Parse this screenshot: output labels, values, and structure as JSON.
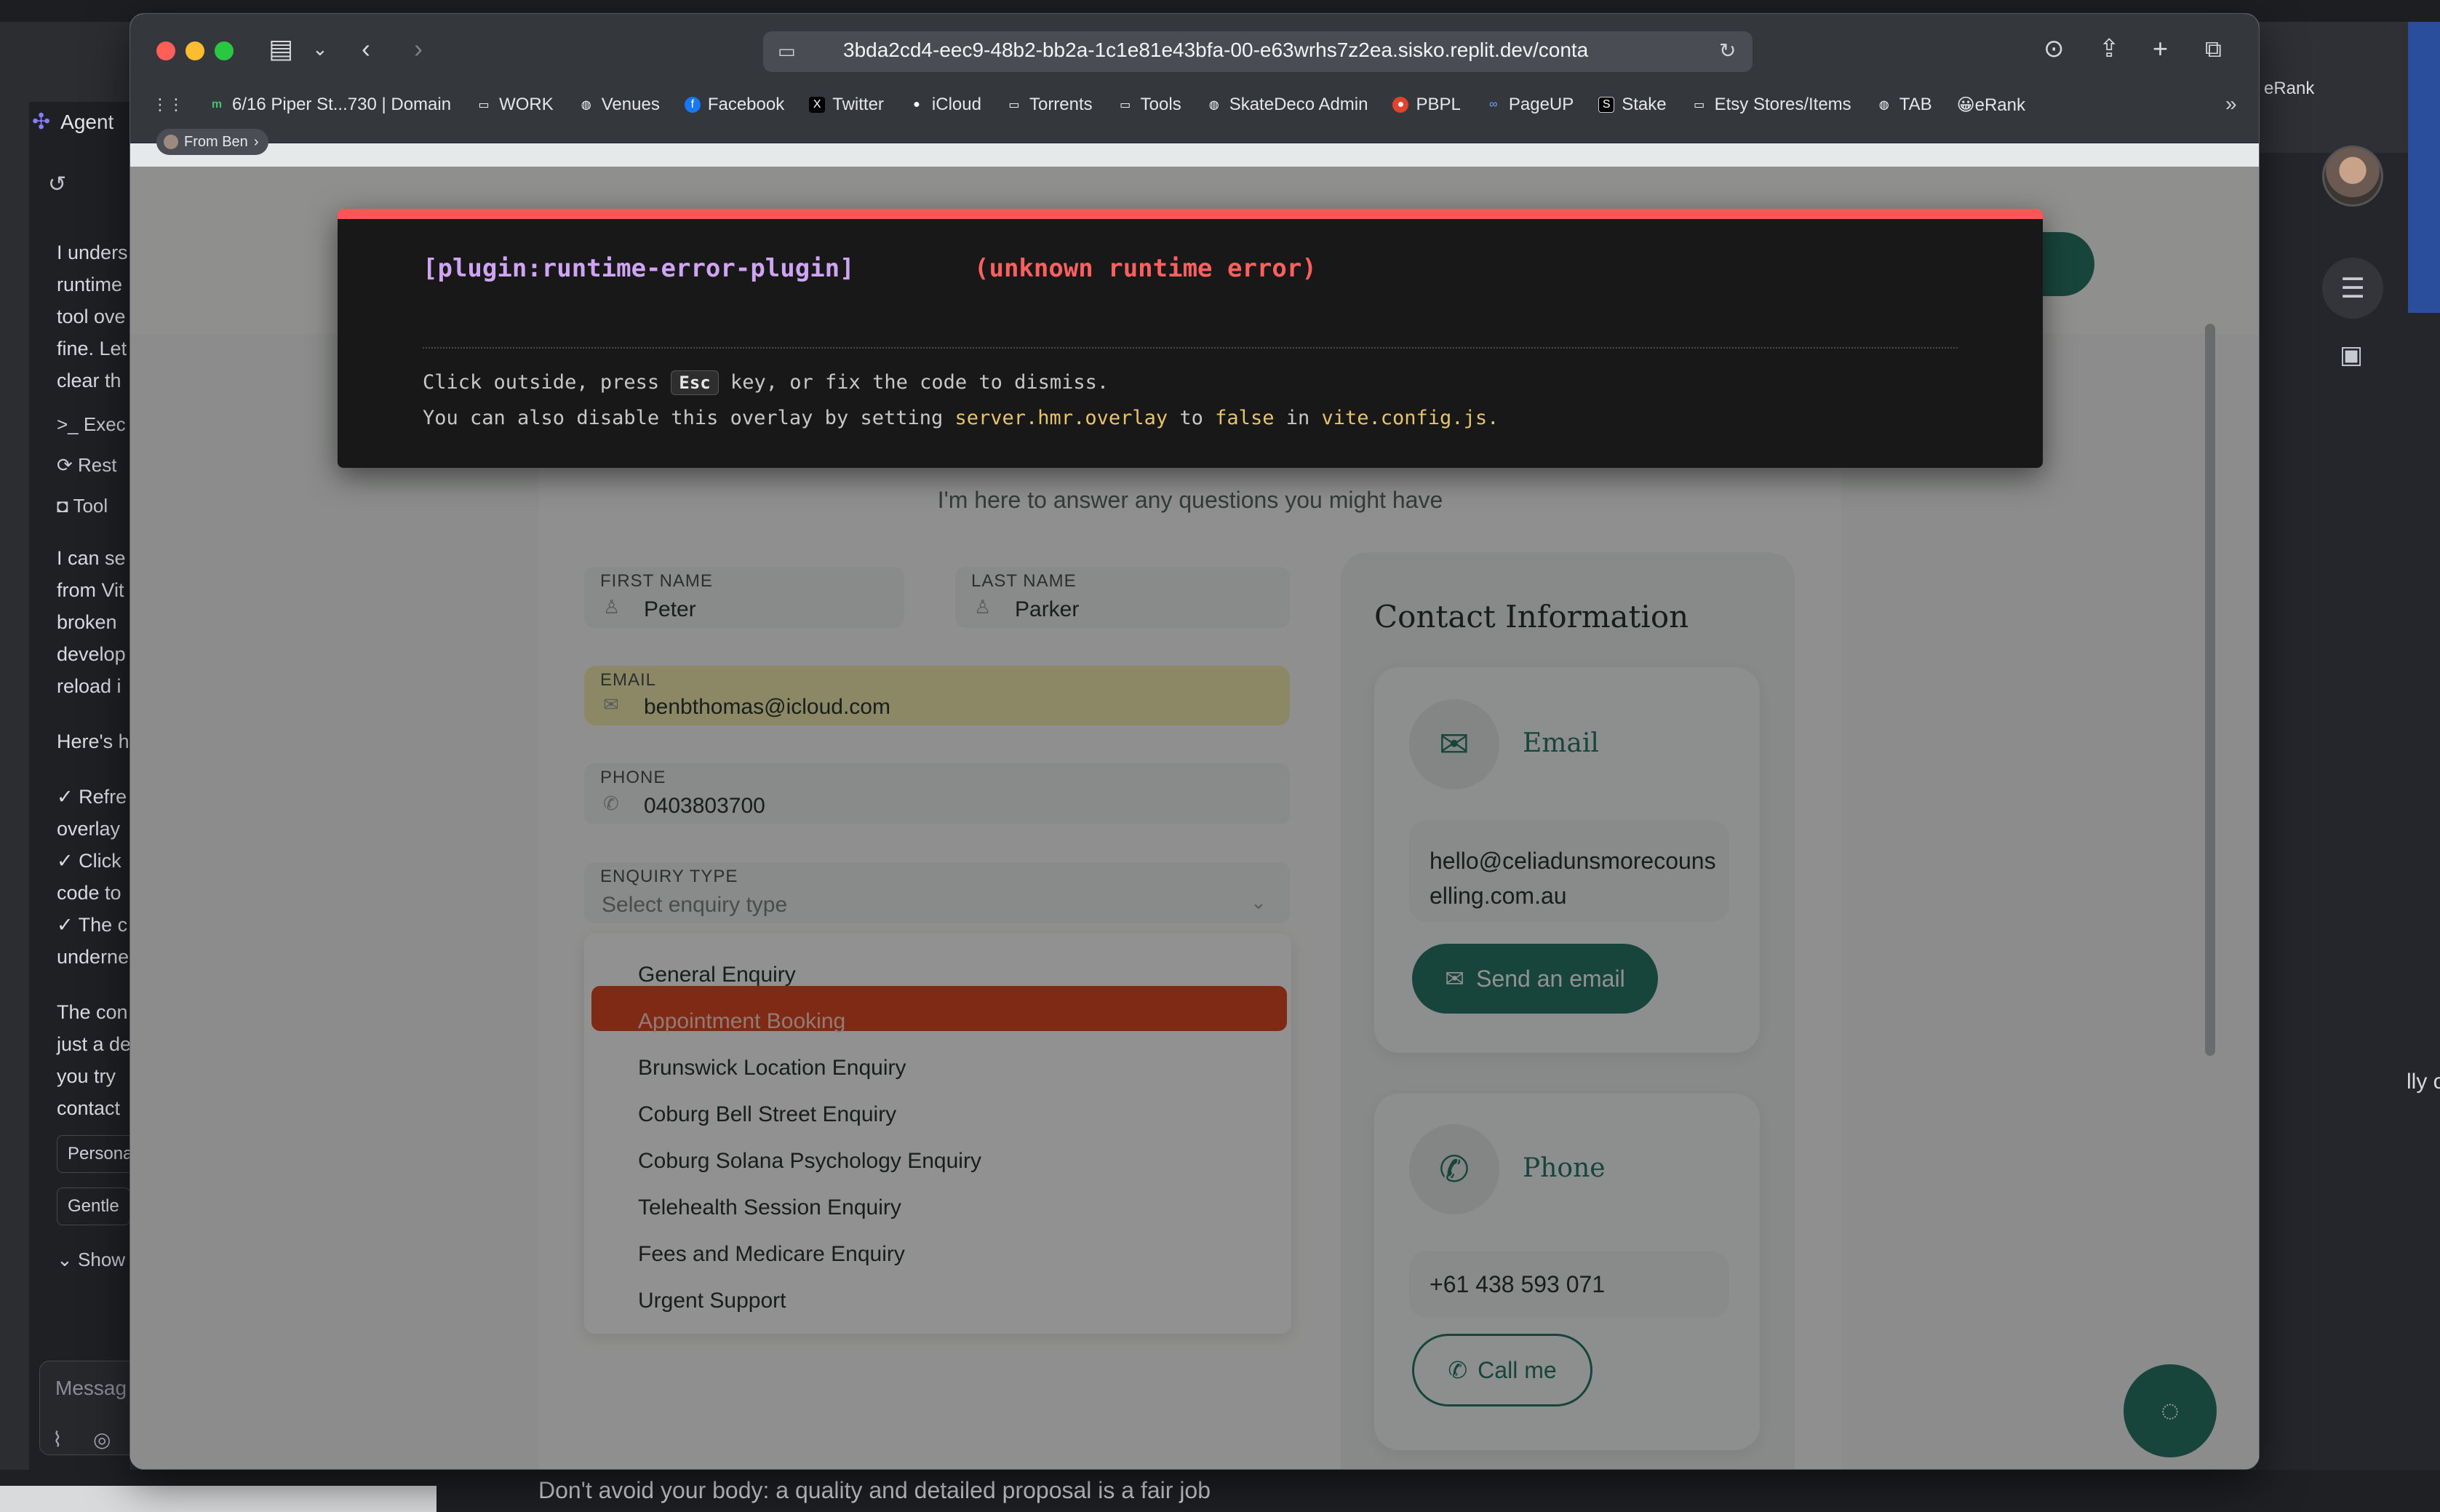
{
  "background": {
    "agent_panel": {
      "title": "Agent",
      "lines": [
        "I unders",
        "runtime",
        "tool ove",
        "fine. Let",
        "clear th"
      ],
      "tools": [
        "Exec",
        "Rest",
        "Tool"
      ],
      "lines2": [
        "I can se",
        "from Vit",
        "broken",
        "develop",
        "reload i"
      ],
      "lines3": [
        "Here's h"
      ],
      "checks": [
        "✓ Refre",
        "overlay",
        "✓ Click",
        "code to",
        "✓ The c",
        "underne"
      ],
      "lines4": [
        "The con",
        "just a de",
        "you try",
        "contact"
      ],
      "chips": [
        "Persona",
        "Gentle"
      ],
      "show_label": "Show",
      "input_placeholder": "Messag"
    },
    "right_panel": {
      "tab_label": "eRank",
      "side_text": "lly c"
    },
    "bottom_text": "Don't avoid your body: a quality and detailed proposal is a fair job"
  },
  "browser": {
    "url": "3bda2cd4-eec9-48b2-bb2a-1c1e81e43bfa-00-e63wrhs7z2ea.sisko.replit.dev/conta",
    "bookmarks": [
      {
        "label": "6/16 Piper St...730 | Domain",
        "icon": "domain-icon"
      },
      {
        "label": "WORK",
        "icon": "folder-icon"
      },
      {
        "label": "Venues",
        "icon": "globe-icon"
      },
      {
        "label": "Facebook",
        "icon": "facebook-icon"
      },
      {
        "label": "Twitter",
        "icon": "x-icon"
      },
      {
        "label": "iCloud",
        "icon": "apple-icon"
      },
      {
        "label": "Torrents",
        "icon": "folder-icon"
      },
      {
        "label": "Tools",
        "icon": "folder-icon"
      },
      {
        "label": "SkateDeco Admin",
        "icon": "globe-icon"
      },
      {
        "label": "PBPL",
        "icon": "pbpl-icon"
      },
      {
        "label": "PageUP",
        "icon": "pageup-icon"
      },
      {
        "label": "Stake",
        "icon": "stake-icon"
      },
      {
        "label": "Etsy Stores/Items",
        "icon": "folder-icon"
      },
      {
        "label": "TAB",
        "icon": "globe-icon"
      },
      {
        "label": "😀eRank",
        "icon": "emoji-icon"
      }
    ],
    "shared_from": "From Ben"
  },
  "page": {
    "subtitle": "I'm here to answer any questions you might have",
    "form": {
      "first_name": {
        "label": "FIRST NAME",
        "value": "Peter"
      },
      "last_name": {
        "label": "LAST NAME",
        "value": "Parker"
      },
      "email": {
        "label": "EMAIL",
        "value": "benbthomas@icloud.com"
      },
      "phone": {
        "label": "PHONE",
        "value": "0403803700"
      },
      "enquiry_type": {
        "label": "ENQUIRY TYPE",
        "placeholder": "Select enquiry type"
      },
      "options": [
        "General Enquiry",
        "Appointment Booking",
        "Brunswick Location Enquiry",
        "Coburg Bell Street Enquiry",
        "Coburg Solana Psychology Enquiry",
        "Telehealth Session Enquiry",
        "Fees and Medicare Enquiry",
        "Urgent Support"
      ],
      "highlighted_option": "Appointment Booking"
    },
    "contact": {
      "title": "Contact Information",
      "email_card": {
        "title": "Email",
        "value": "hello@celiadunsmorecounselling.com.au",
        "button": "Send an email"
      },
      "phone_card": {
        "title": "Phone",
        "value": "+61 438 593 071",
        "button": "Call me"
      }
    }
  },
  "error_overlay": {
    "plugin": "[plugin:runtime-error-plugin]",
    "message": "(unknown runtime error)",
    "line1_prefix": "Click outside, press",
    "line1_key": "Esc",
    "line1_suffix": "key, or fix the code to dismiss.",
    "line2_prefix": "You can also disable this overlay by setting",
    "line2_code1": "server.hmr.overlay",
    "line2_mid1": "to",
    "line2_code2": "false",
    "line2_mid2": "in",
    "line2_code3": "vite.config.js",
    "line2_end": "."
  },
  "colors": {
    "accent": "#2b7a68",
    "error_red": "#ff5555",
    "highlight_orange": "#e04a26",
    "autofill_yellow": "#f7f0b3"
  }
}
